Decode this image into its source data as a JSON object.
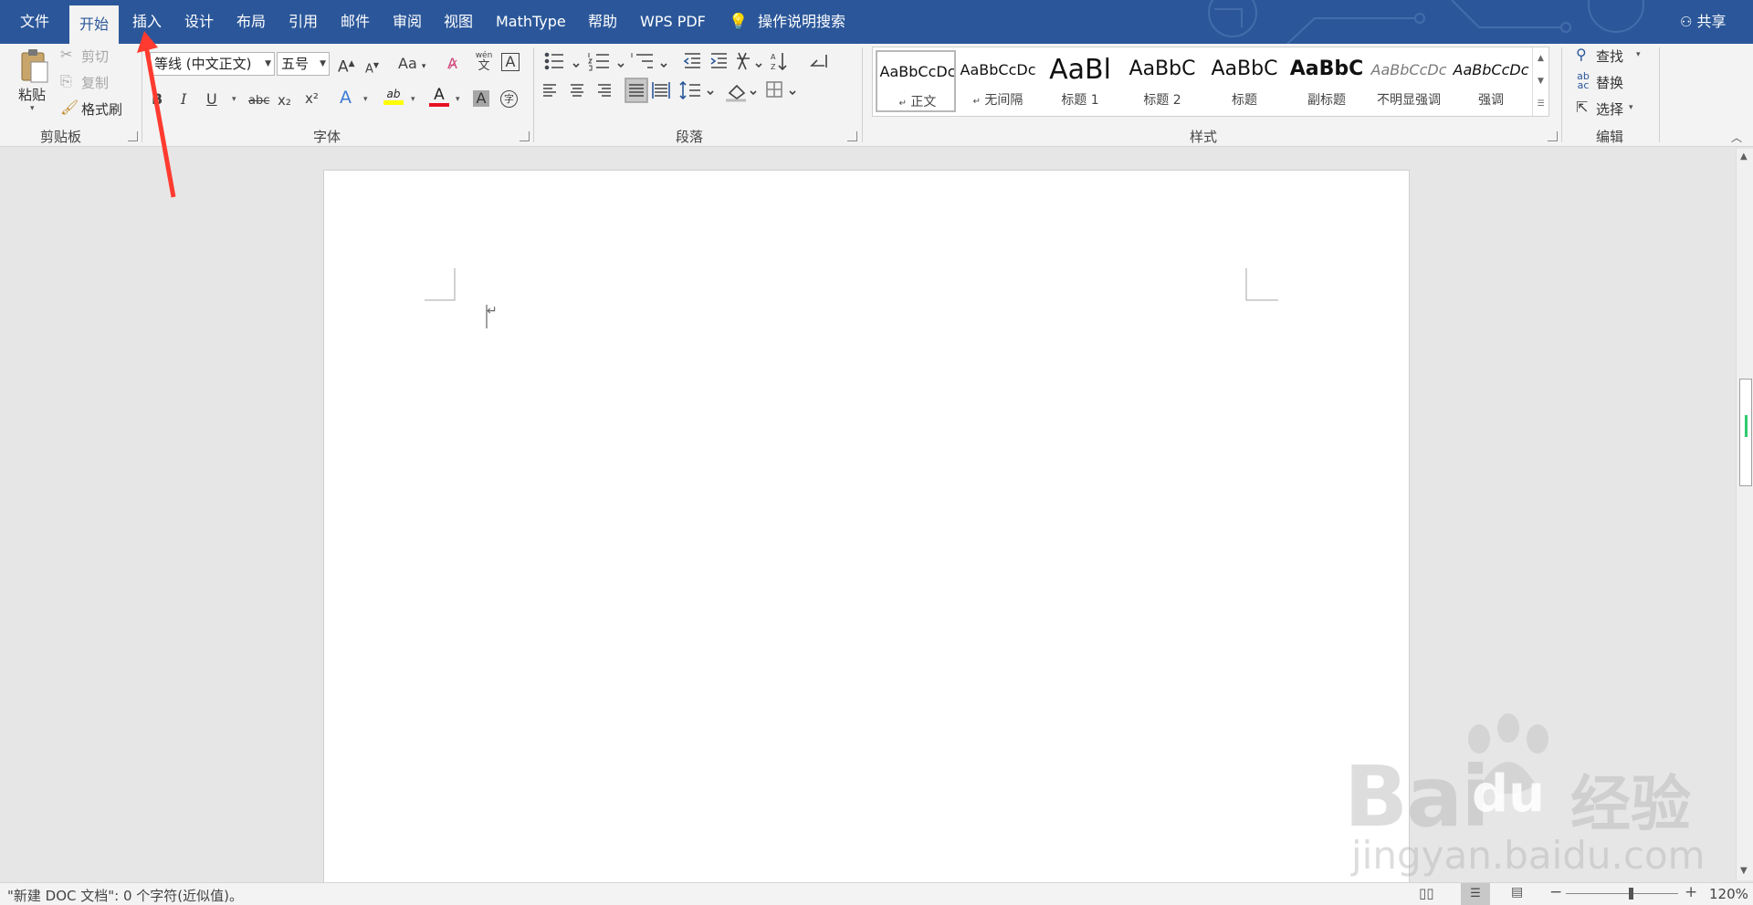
{
  "tabs": [
    {
      "label": "文件",
      "active": false
    },
    {
      "label": "开始",
      "active": true
    },
    {
      "label": "插入",
      "active": false
    },
    {
      "label": "设计",
      "active": false
    },
    {
      "label": "布局",
      "active": false
    },
    {
      "label": "引用",
      "active": false
    },
    {
      "label": "邮件",
      "active": false
    },
    {
      "label": "审阅",
      "active": false
    },
    {
      "label": "视图",
      "active": false
    },
    {
      "label": "MathType",
      "active": false
    },
    {
      "label": "帮助",
      "active": false
    },
    {
      "label": "WPS PDF",
      "active": false
    }
  ],
  "tell_me": "操作说明搜索",
  "share": "共享",
  "clipboard": {
    "paste": "粘贴",
    "cut": "剪切",
    "copy": "复制",
    "format_painter": "格式刷",
    "label": "剪贴板"
  },
  "font": {
    "name": "等线 (中文正文)",
    "size": "五号",
    "label": "字体",
    "change_case": "Aa",
    "phonetic_top": "wén",
    "phonetic_bottom": "文",
    "bold": "B",
    "italic": "I",
    "underline": "U",
    "strike": "abc",
    "subscript": "x₂",
    "superscript": "x²",
    "text_effects": "A",
    "highlight": "ab",
    "font_color": "A",
    "char_shading": "A",
    "enclose": "字",
    "grow": "A",
    "shrink": "A",
    "char_border": "A"
  },
  "paragraph": {
    "label": "段落"
  },
  "styles": {
    "label": "样式",
    "items": [
      {
        "preview": "AaBbCcDc",
        "name": "正文",
        "selected": true,
        "mark": "↵"
      },
      {
        "preview": "AaBbCcDc",
        "name": "无间隔",
        "selected": false,
        "mark": "↵"
      },
      {
        "preview": "AaBl",
        "name": "标题 1",
        "selected": false
      },
      {
        "preview": "AaBbC",
        "name": "标题 2",
        "selected": false
      },
      {
        "preview": "AaBbC",
        "name": "标题",
        "selected": false
      },
      {
        "preview": "AaBbC",
        "name": "副标题",
        "selected": false
      },
      {
        "preview": "AaBbCcDc",
        "name": "不明显强调",
        "selected": false
      },
      {
        "preview": "AaBbCcDc",
        "name": "强调",
        "selected": false
      }
    ]
  },
  "editing": {
    "find": "查找",
    "replace": "替换",
    "select": "选择",
    "label": "编辑",
    "replace_icon_top": "ab",
    "replace_icon_bottom": "ac"
  },
  "document": {
    "paragraph_mark": "↵"
  },
  "status": {
    "doc_info": "\"新建 DOC 文档\": 0 个字符(近似值)。",
    "zoom": "120%",
    "zoom_fraction": 0.58
  },
  "watermark": {
    "brand": "Bai",
    "brand2": "du",
    "cn": "经验",
    "url": "jingyan.baidu.com"
  },
  "colors": {
    "accent": "#2b579a",
    "arrow": "#ff3b30",
    "highlight": "#ffff00",
    "font_color": "#e81123"
  }
}
